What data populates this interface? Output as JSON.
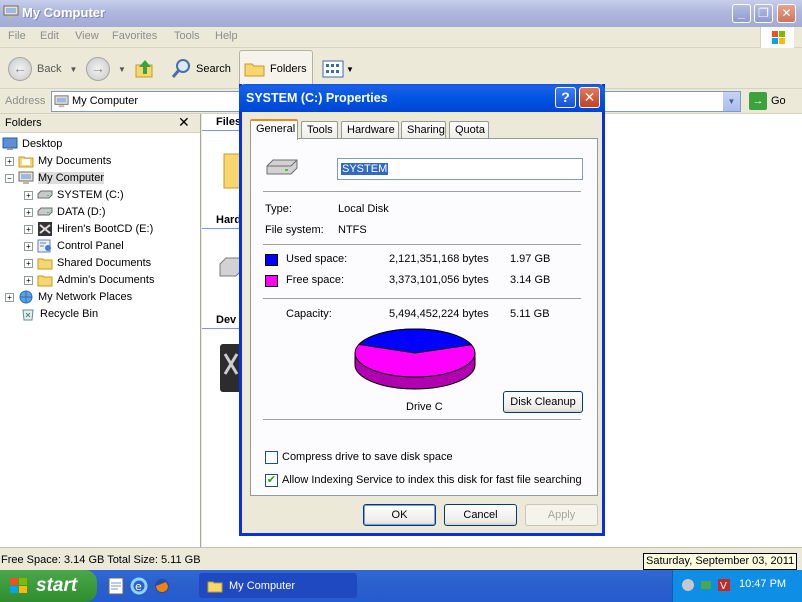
{
  "window": {
    "title": "My Computer",
    "menu": [
      "File",
      "Edit",
      "View",
      "Favorites",
      "Tools",
      "Help"
    ],
    "toolbar": {
      "back": "Back",
      "search": "Search",
      "folders": "Folders"
    },
    "address": {
      "label": "Address",
      "value": "My Computer",
      "go": "Go"
    }
  },
  "folders_pane": {
    "title": "Folders",
    "tree": [
      {
        "label": "Desktop",
        "icon": "desktop-icon"
      },
      {
        "label": "My Documents",
        "icon": "folder-icon"
      },
      {
        "label": "My Computer",
        "icon": "computer-icon"
      },
      {
        "label": "SYSTEM (C:)",
        "icon": "drive-icon"
      },
      {
        "label": "DATA (D:)",
        "icon": "drive-icon"
      },
      {
        "label": "Hiren's BootCD (E:)",
        "icon": "cd-icon"
      },
      {
        "label": "Control Panel",
        "icon": "control-panel-icon"
      },
      {
        "label": "Shared Documents",
        "icon": "folder-icon"
      },
      {
        "label": "Admin's Documents",
        "icon": "folder-icon"
      },
      {
        "label": "My Network Places",
        "icon": "network-icon"
      },
      {
        "label": "Recycle Bin",
        "icon": "recycle-bin-icon"
      }
    ]
  },
  "content": {
    "groups": [
      "Files",
      "Hard",
      "Dev"
    ]
  },
  "statusbar": {
    "text": "Free Space: 3.14 GB Total Size: 5.11 GB",
    "tooltip": "Saturday, September 03, 2011"
  },
  "taskbar": {
    "start": "start",
    "task": "My Computer",
    "clock": "10:47 PM"
  },
  "dialog": {
    "title": "SYSTEM (C:) Properties",
    "tabs": [
      "General",
      "Tools",
      "Hardware",
      "Sharing",
      "Quota"
    ],
    "name": "SYSTEM",
    "type_label": "Type:",
    "type_value": "Local Disk",
    "fs_label": "File system:",
    "fs_value": "NTFS",
    "used_label": "Used space:",
    "used_bytes": "2,121,351,168 bytes",
    "used_gb": "1.97 GB",
    "free_label": "Free space:",
    "free_bytes": "3,373,101,056 bytes",
    "free_gb": "3.14 GB",
    "cap_label": "Capacity:",
    "cap_bytes": "5,494,452,224 bytes",
    "cap_gb": "5.11 GB",
    "used_fraction": 0.386,
    "used_color": "#0000ff",
    "free_color": "#ff00ff",
    "drive_label": "Drive C",
    "cleanup": "Disk Cleanup",
    "compress": "Compress drive to save disk space",
    "indexing": "Allow Indexing Service to index this disk for fast file searching",
    "compress_checked": false,
    "indexing_checked": true,
    "ok": "OK",
    "cancel": "Cancel",
    "apply": "Apply"
  }
}
